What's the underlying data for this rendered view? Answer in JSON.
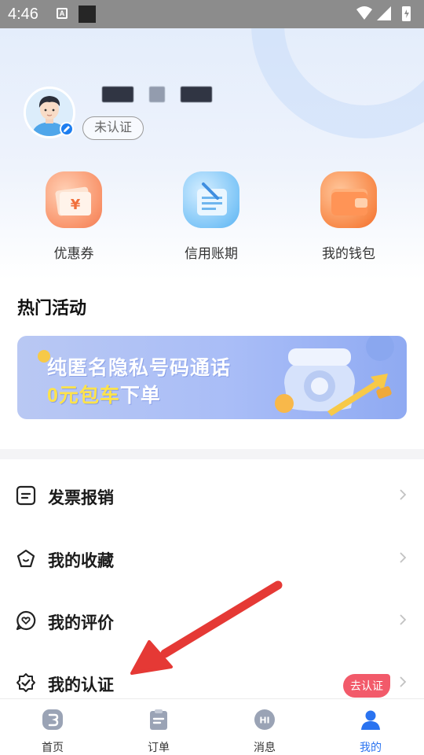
{
  "status_bar": {
    "time": "4:46",
    "notif_icon": "a-icon"
  },
  "profile": {
    "auth_status": "未认证"
  },
  "quick_actions": [
    {
      "label": "优惠券",
      "icon": "coupon-icon"
    },
    {
      "label": "信用账期",
      "icon": "credit-bill-icon"
    },
    {
      "label": "我的钱包",
      "icon": "wallet-icon"
    }
  ],
  "hot_activity": {
    "title": "热门活动",
    "banner_line1": "纯匿名隐私号码通话",
    "banner_line2_highlight": "0元包车",
    "banner_line2_rest": "下单"
  },
  "menu": [
    {
      "label": "发票报销",
      "icon": "invoice-icon"
    },
    {
      "label": "我的收藏",
      "icon": "favorite-icon"
    },
    {
      "label": "我的评价",
      "icon": "review-icon"
    },
    {
      "label": "我的认证",
      "icon": "verify-icon",
      "badge": "去认证"
    }
  ],
  "tabbar": [
    {
      "label": "首页",
      "icon": "home-icon",
      "active": false
    },
    {
      "label": "订单",
      "icon": "order-icon",
      "active": false
    },
    {
      "label": "消息",
      "icon": "message-icon",
      "active": false
    },
    {
      "label": "我的",
      "icon": "profile-icon",
      "active": true
    }
  ],
  "colors": {
    "accent": "#2a73f0",
    "badge": "#f25a6a",
    "annotation_arrow": "#e53935"
  }
}
